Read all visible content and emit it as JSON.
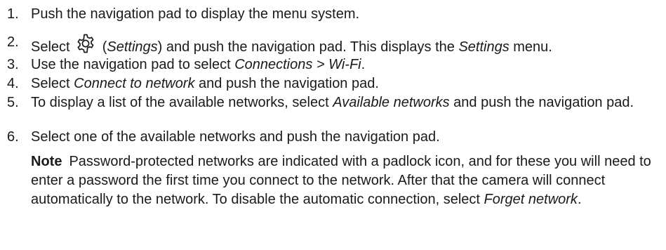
{
  "steps": [
    {
      "number": "1.",
      "text": "Push the navigation pad to display the menu system."
    },
    {
      "number": "2.",
      "select": "Select",
      "icon": "settings-gear-icon",
      "paren_open": " (",
      "settings_italic": "Settings",
      "paren_close": ") and push the navigation pad. This displays the ",
      "settings_menu_italic": "Settings",
      "menu_word": " menu."
    },
    {
      "number": "3.",
      "prefix": "Use the navigation pad to select ",
      "path_italic": "Connections > Wi-Fi",
      "suffix": "."
    },
    {
      "number": "4.",
      "prefix": "Select ",
      "option_italic": "Connect to network",
      "suffix": " and push the navigation pad."
    },
    {
      "number": "5.",
      "prefix": "To display a list of the available networks, select ",
      "option_italic": "Available networks",
      "suffix": " and push the navigation pad."
    },
    {
      "number": "6.",
      "text": "Select one of the available networks and push the navigation pad."
    }
  ],
  "note": {
    "label": "Note",
    "text": "Password-protected networks are indicated with a padlock icon, and for these you will need to enter a password the first time you connect to the network. After that the camera will connect automatically to the network. To disable the automatic connection, select ",
    "option_italic": "Forget network",
    "suffix": "."
  }
}
